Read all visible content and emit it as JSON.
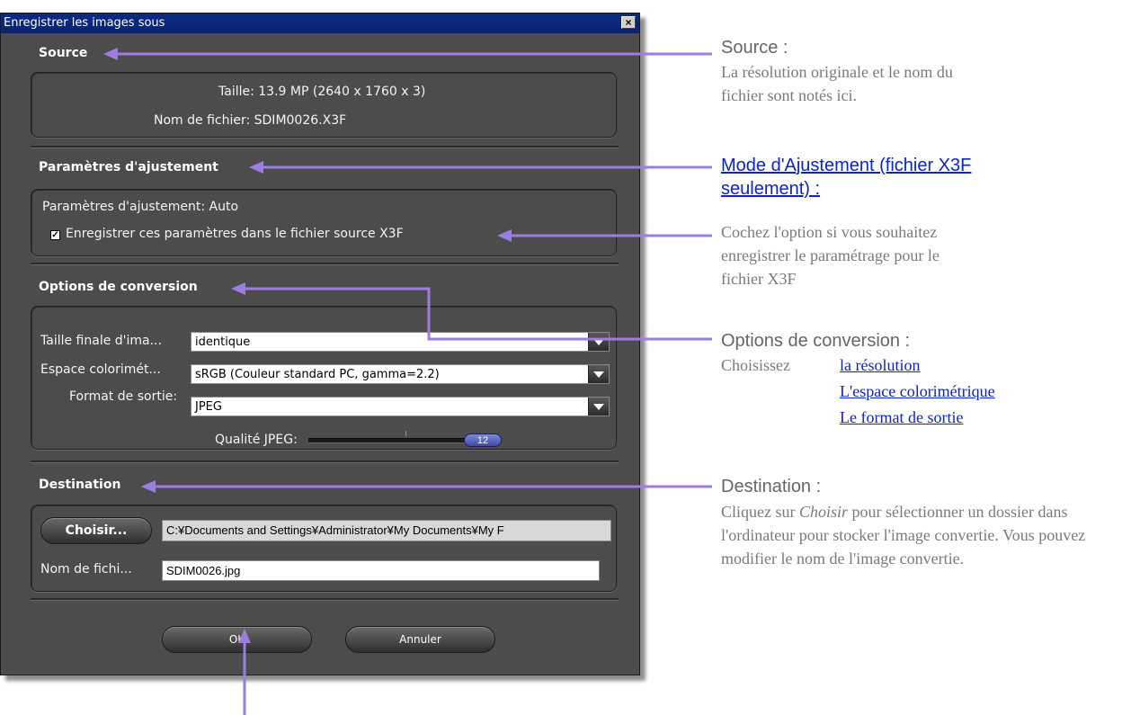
{
  "dialog": {
    "title": "Enregistrer les images sous",
    "close_glyph": "×",
    "source": {
      "heading": "Source",
      "size_line": "Taille: 13.9 MP (2640 x 1760 x 3)",
      "file_line": "Nom de fichier: SDIM0026.X3F"
    },
    "adjust": {
      "heading": "Paramètres d'ajustement",
      "setting_line": "Paramètres d'ajustement: Auto",
      "save_checkbox_label": "Enregistrer ces paramètres dans le fichier source X3F",
      "save_checked": true
    },
    "conversion": {
      "heading": "Options de conversion",
      "size_label": "Taille finale d'ima...",
      "size_value": "identique",
      "color_label": "Espace colorimét...",
      "color_value": "sRGB (Couleur standard PC, gamma=2.2)",
      "format_label": "Format de sortie:",
      "format_value": "JPEG",
      "quality_label": "Qualité JPEG:",
      "quality_value": "12"
    },
    "destination": {
      "heading": "Destination",
      "choose_button": "Choisir...",
      "path": "C:¥Documents and Settings¥Administrator¥My Documents¥My F",
      "filename_label": "Nom de fichi...",
      "filename_value": "SDIM0026.jpg"
    },
    "ok_button": "OK",
    "cancel_button": "Annuler"
  },
  "annotations": {
    "source": {
      "heading": "Source :",
      "body": "La résolution originale et le nom du fichier sont notés ici."
    },
    "adjust": {
      "heading_link": "Mode d'Ajustement (fichier X3F seulement) :",
      "body": "Cochez l'option si vous souhaitez enregistrer le paramétrage pour le fichier X3F"
    },
    "conversion": {
      "heading": "Options de conversion :",
      "intro": "Choisissez",
      "link_resolution": "la résolution",
      "link_colorspace": "L'espace colorimétrique",
      "link_format": "Le format de sortie"
    },
    "destination": {
      "heading": "Destination :",
      "body_pre": "Cliquez sur ",
      "body_em": "Choisir",
      "body_post": " pour sélectionner un dossier dans l'ordinateur pour stocker l'image convertie.  Vous pouvez modifier le nom de l'image convertie."
    }
  },
  "colors": {
    "dialog_bg": "#4c4c4c",
    "arrow": "#9b7ee0",
    "link": "#0a22d8",
    "slider": "#5060c8"
  }
}
